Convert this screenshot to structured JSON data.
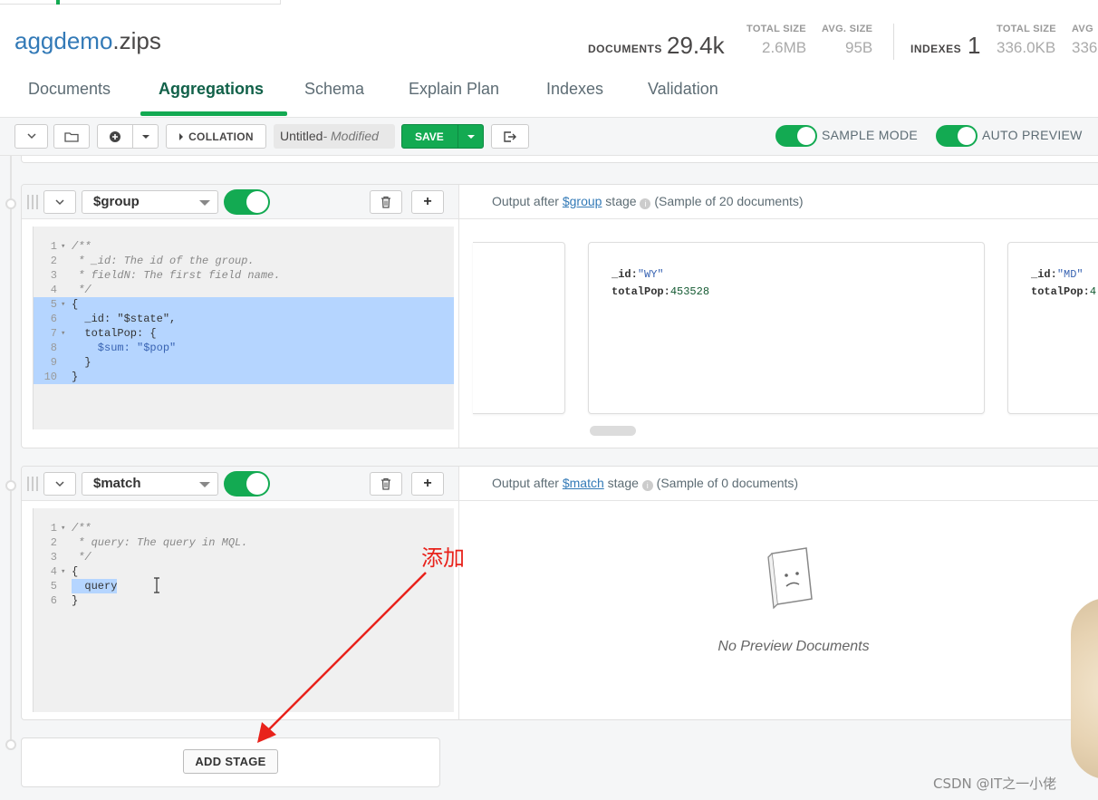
{
  "header": {
    "db_name": "aggdemo",
    "collection_suffix": ".zips",
    "documents_label": "DOCUMENTS",
    "documents_value": "29.4k",
    "doc_total_size_label": "TOTAL SIZE",
    "doc_total_size_value": "2.6MB",
    "doc_avg_size_label": "AVG. SIZE",
    "doc_avg_size_value": "95B",
    "indexes_label": "INDEXES",
    "indexes_value": "1",
    "idx_total_size_label": "TOTAL SIZE",
    "idx_total_size_value": "336.0KB",
    "idx_avg_size_label": "AVG",
    "idx_avg_size_value": "336"
  },
  "tabs": [
    {
      "label": "Documents"
    },
    {
      "label": "Aggregations"
    },
    {
      "label": "Schema"
    },
    {
      "label": "Explain Plan"
    },
    {
      "label": "Indexes"
    },
    {
      "label": "Validation"
    }
  ],
  "active_tab": "Aggregations",
  "toolbar": {
    "collation_label": "COLLATION",
    "pipeline_name": "Untitled",
    "pipeline_status": "- Modified",
    "save_label": "SAVE",
    "sample_mode_label": "SAMPLE MODE",
    "auto_preview_label": "AUTO PREVIEW"
  },
  "stages": [
    {
      "operator": "$group",
      "enabled": true,
      "preview_prefix": "Output after ",
      "preview_suffix": " stage",
      "preview_sample": "(Sample of 20 documents)",
      "code_lines": [
        {
          "n": "1",
          "fold": "▾",
          "text": "/**",
          "kind": "comment"
        },
        {
          "n": "2",
          "fold": "",
          "text": " * _id: The id of the group.",
          "kind": "comment"
        },
        {
          "n": "3",
          "fold": "",
          "text": " * fieldN: The first field name.",
          "kind": "comment"
        },
        {
          "n": "4",
          "fold": "",
          "text": " */",
          "kind": "comment"
        },
        {
          "n": "5",
          "fold": "▾",
          "text": "{",
          "kind": "brace"
        },
        {
          "n": "6",
          "fold": "",
          "text": "  _id: \"$state\",",
          "kind": "key"
        },
        {
          "n": "7",
          "fold": "▾",
          "text": "  totalPop: {",
          "kind": "key"
        },
        {
          "n": "8",
          "fold": "",
          "text": "    $sum: \"$pop\"",
          "kind": "op"
        },
        {
          "n": "9",
          "fold": "",
          "text": "  }",
          "kind": "brace"
        },
        {
          "n": "10",
          "fold": "",
          "text": "}",
          "kind": "brace"
        }
      ],
      "documents": [
        {
          "id_key": "_id:",
          "id_value": "\"WY\"",
          "pop_key": "totalPop:",
          "pop_value": "453528"
        },
        {
          "id_key": "_id:",
          "id_value": "\"MD\"",
          "pop_key": "totalPop:",
          "pop_value": "4"
        }
      ]
    },
    {
      "operator": "$match",
      "enabled": true,
      "preview_prefix": "Output after ",
      "preview_suffix": " stage",
      "preview_sample": "(Sample of 0 documents)",
      "code_lines": [
        {
          "n": "1",
          "fold": "▾",
          "text": "/**",
          "kind": "comment"
        },
        {
          "n": "2",
          "fold": "",
          "text": " * query: The query in MQL.",
          "kind": "comment"
        },
        {
          "n": "3",
          "fold": "",
          "text": " */",
          "kind": "comment"
        },
        {
          "n": "4",
          "fold": "▾",
          "text": "{",
          "kind": "brace"
        },
        {
          "n": "5",
          "fold": "",
          "text": "  query",
          "kind": "key"
        },
        {
          "n": "6",
          "fold": "",
          "text": "}",
          "kind": "brace"
        }
      ],
      "empty_text": "No Preview Documents"
    }
  ],
  "add_stage_label": "ADD STAGE",
  "annotation": "添加",
  "watermark": "CSDN @IT之一小佬",
  "colors": {
    "accent_green": "#13aa52",
    "link_blue": "#337ab7",
    "annotation_red": "#e8221b",
    "selection_blue": "#b5d5ff"
  }
}
